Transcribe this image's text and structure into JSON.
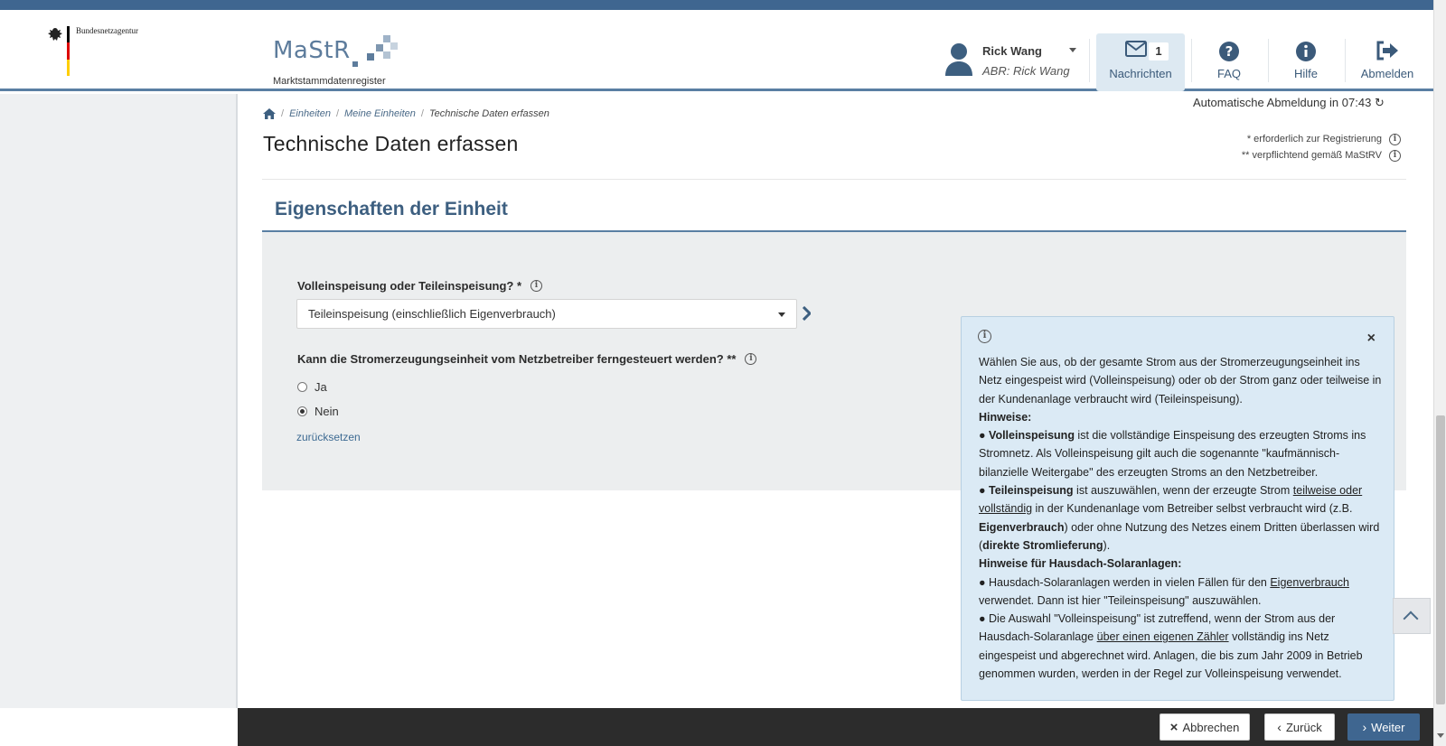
{
  "header": {
    "agency": "Bundesnetzagentur",
    "logo_word": "MaStR",
    "logo_sub": "Marktstammdatenregister",
    "user_name": "Rick Wang",
    "user_abr": "ABR: Rick Wang",
    "nav": {
      "messages_label": "Nachrichten",
      "messages_count": "1",
      "faq_label": "FAQ",
      "help_label": "Hilfe",
      "logout_label": "Abmelden"
    }
  },
  "session": {
    "auto_logout": "Automatische Abmeldung in 07:43"
  },
  "breadcrumb": {
    "items": [
      "Einheiten",
      "Meine Einheiten",
      "Technische Daten erfassen"
    ]
  },
  "page": {
    "title": "Technische Daten erfassen",
    "legend_required": "* erforderlich zur Registrierung",
    "legend_mandatory": "** verpflichtend gemäß MaStRV"
  },
  "section": {
    "title": "Eigenschaften der Einheit",
    "feed_in_label": "Volleinspeisung oder Teileinspeisung? *",
    "feed_in_value": "Teileinspeisung (einschließlich Eigenverbrauch)",
    "remote_label": "Kann die Stromerzeugungseinheit vom Netzbetreiber ferngesteuert werden? **",
    "radio_yes": "Ja",
    "radio_no": "Nein",
    "reset": "zurücksetzen"
  },
  "tooltip": {
    "intro": "Wählen Sie aus, ob der gesamte Strom aus der Stromerzeugungseinheit ins Netz eingespeist wird (Volleinspeisung) oder ob der Strom ganz oder teilweise in der Kundenanlage verbraucht wird (Teileinspeisung).",
    "hint_head": "Hinweise:",
    "bullet1_bold": "Volleinspeisung",
    "bullet1_text": " ist die vollständige Einspeisung des erzeugten Stroms ins Stromnetz. Als Volleinspeisung gilt auch die sogenannte \"kaufmännisch-bilanzielle Weitergabe\" des erzeugten Stroms an den Netzbetreiber.",
    "bullet2_bold": "Teileinspeisung",
    "bullet2_a": " ist auszuwählen, wenn der erzeugte Strom ",
    "bullet2_u": "teilweise oder vollständig",
    "bullet2_b": " in der Kundenanlage vom Betreiber selbst verbraucht wird (z.B. ",
    "bullet2_bold2": "Eigenverbrauch",
    "bullet2_c": ") oder ohne Nutzung des Netzes einem Dritten überlassen wird (",
    "bullet2_bold3": "direkte Stromlieferung",
    "bullet2_d": ").",
    "solar_head": "Hinweise für Hausdach-Solaranlagen:",
    "bullet3_a": "Hausdach-Solaranlagen werden in vielen Fällen für den ",
    "bullet3_u": "Eigenverbrauch",
    "bullet3_b": " verwendet. Dann ist hier \"Teileinspeisung\" auszuwählen.",
    "bullet4_a": "Die Auswahl \"Volleinspeisung\" ist zutreffend, wenn der Strom aus der Hausdach-Solaranlage ",
    "bullet4_u": "über einen eigenen Zähler",
    "bullet4_b": " vollständig ins Netz eingespeist und abgerechnet wird. Anlagen, die bis zum Jahr 2009 in Betrieb genommen wurden, werden in der Regel zur Volleinspeisung verwendet."
  },
  "footer": {
    "cancel": "Abbrechen",
    "back": "Zurück",
    "next": "Weiter"
  },
  "colors": {
    "primary": "#3f6690",
    "section_title": "#3d5f80",
    "tooltip_bg": "#dbeaf5",
    "footer_bg": "#2c2c2c"
  }
}
